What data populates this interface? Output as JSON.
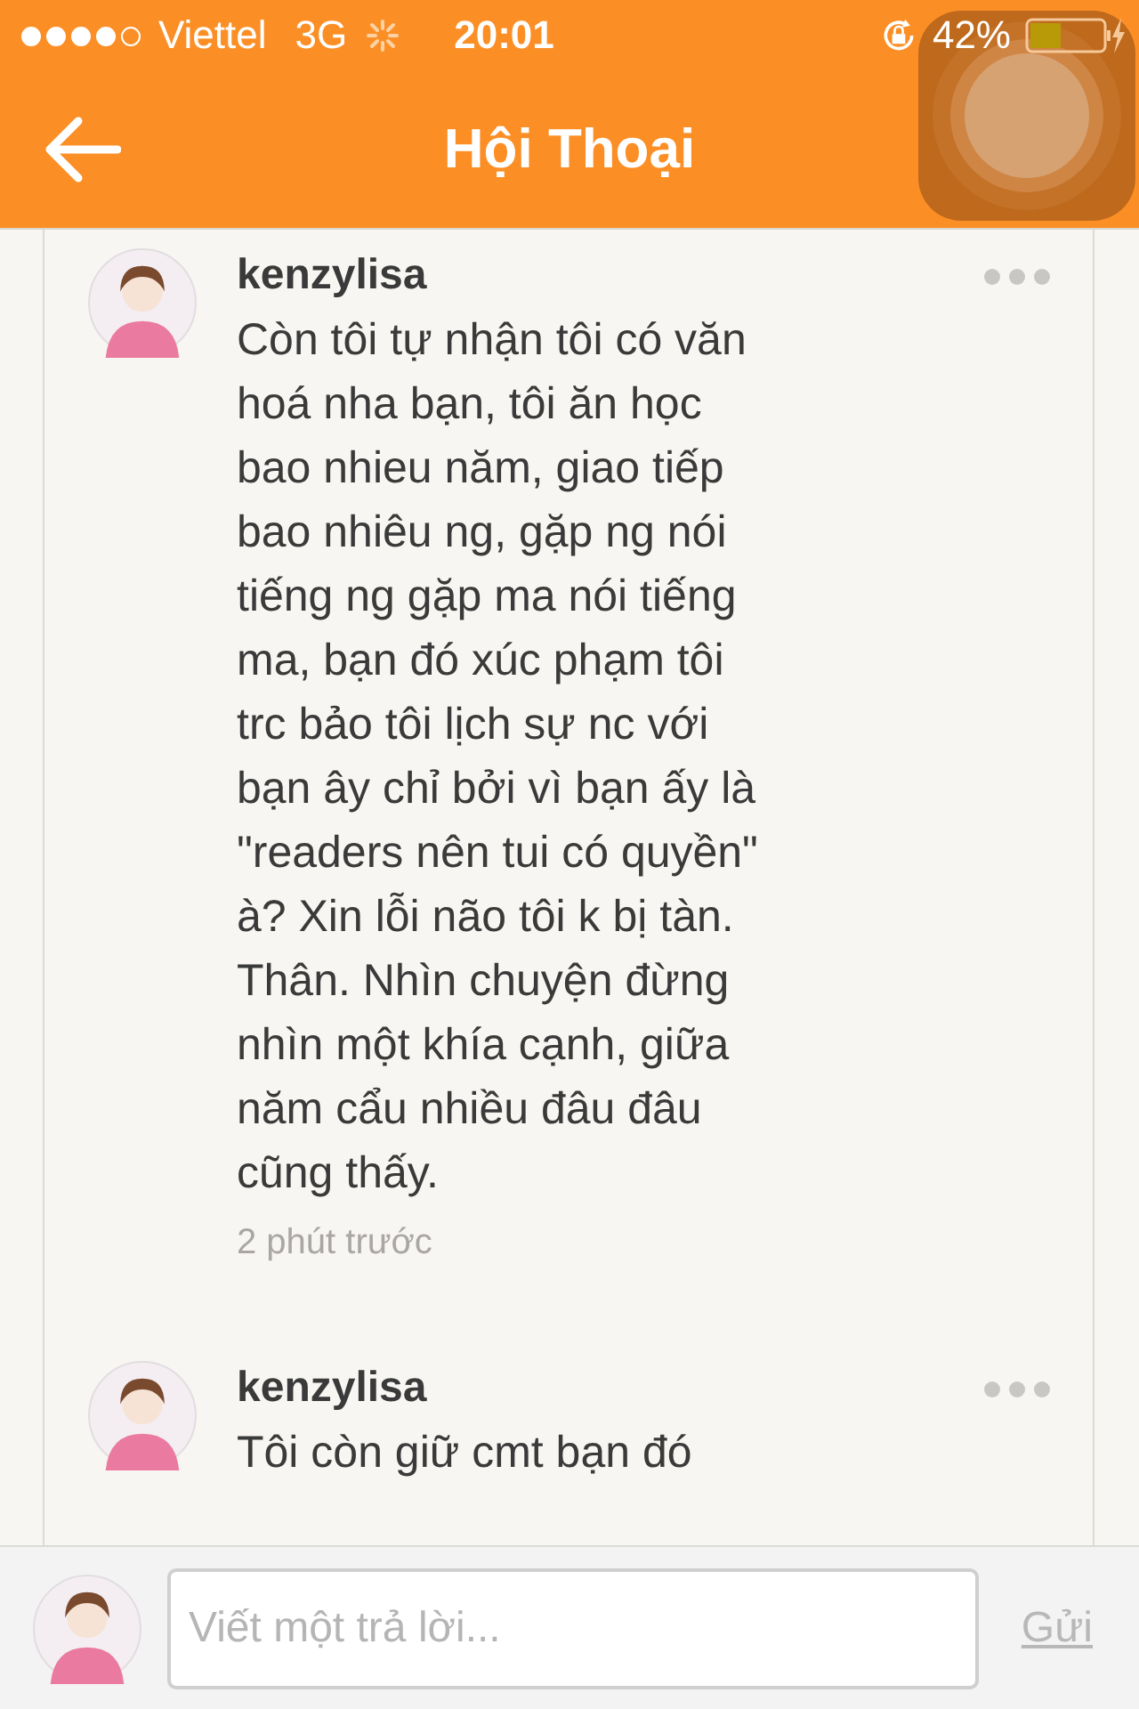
{
  "status_bar": {
    "carrier": "Viettel",
    "network": "3G",
    "time": "20:01",
    "battery": "42%"
  },
  "nav": {
    "title": "Hội Thoại"
  },
  "comments": [
    {
      "author": "kenzylisa",
      "text": "Còn tôi tự nhận tôi có văn hoá nha bạn, tôi ăn học bao nhieu năm, giao tiếp bao nhiêu ng, gặp ng nói tiếng ng gặp ma nói tiếng ma, bạn đó xúc phạm tôi trc bảo tôi lịch sự nc với bạn ây chỉ bởi vì bạn ấy là \"readers nên tui có quyền\" à? Xin lỗi não tôi k bị tàn. Thân. Nhìn chuyện đừng nhìn một khía cạnh, giữa năm cẩu nhiều đâu đâu cũng thấy.",
      "time": "2 phút trước"
    },
    {
      "author": "kenzylisa",
      "text": "Tôi còn giữ cmt bạn đó"
    }
  ],
  "composer": {
    "placeholder": "Viết một trả lời...",
    "send": "Gửi"
  }
}
